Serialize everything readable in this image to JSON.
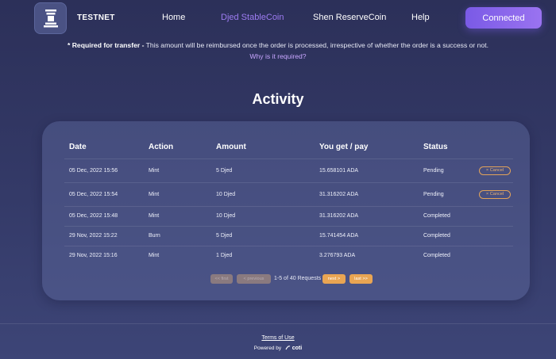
{
  "header": {
    "network": "TESTNET",
    "nav": [
      "Home",
      "Djed StableCoin",
      "Shen ReserveCoin",
      "Help"
    ],
    "connect_label": "Connected"
  },
  "notice": {
    "required_label": "* Required for transfer -",
    "text": " This amount will be reimbursed once the order is processed, irrespective of whether the order is a success or not.",
    "why_link": "Why is it required?"
  },
  "activity": {
    "title": "Activity",
    "columns": [
      "Date",
      "Action",
      "Amount",
      "You get / pay",
      "Status"
    ],
    "rows": [
      {
        "date": "05 Dec, 2022 15:56",
        "action": "Mint",
        "amount": "5 Djed",
        "pay": "15.658101 ADA",
        "status": "Pending",
        "cancel": "× Cancel"
      },
      {
        "date": "05 Dec, 2022 15:54",
        "action": "Mint",
        "amount": "10 Djed",
        "pay": "31.316202 ADA",
        "status": "Pending",
        "cancel": "× Cancel"
      },
      {
        "date": "05 Dec, 2022 15:48",
        "action": "Mint",
        "amount": "10 Djed",
        "pay": "31.316202 ADA",
        "status": "Completed"
      },
      {
        "date": "29 Nov, 2022 15:22",
        "action": "Burn",
        "amount": "5 Djed",
        "pay": "15.741454 ADA",
        "status": "Completed"
      },
      {
        "date": "29 Nov, 2022 15:16",
        "action": "Mint",
        "amount": "1 Djed",
        "pay": "3.276793 ADA",
        "status": "Completed"
      }
    ]
  },
  "pagination": {
    "first": "<< first",
    "previous": "< previous",
    "info": "1-5 of 40 Requests",
    "next": "next >",
    "last": "last >>"
  },
  "footer": {
    "terms": "Terms of Use",
    "powered_by": "Powered by",
    "brand": "coti"
  }
}
